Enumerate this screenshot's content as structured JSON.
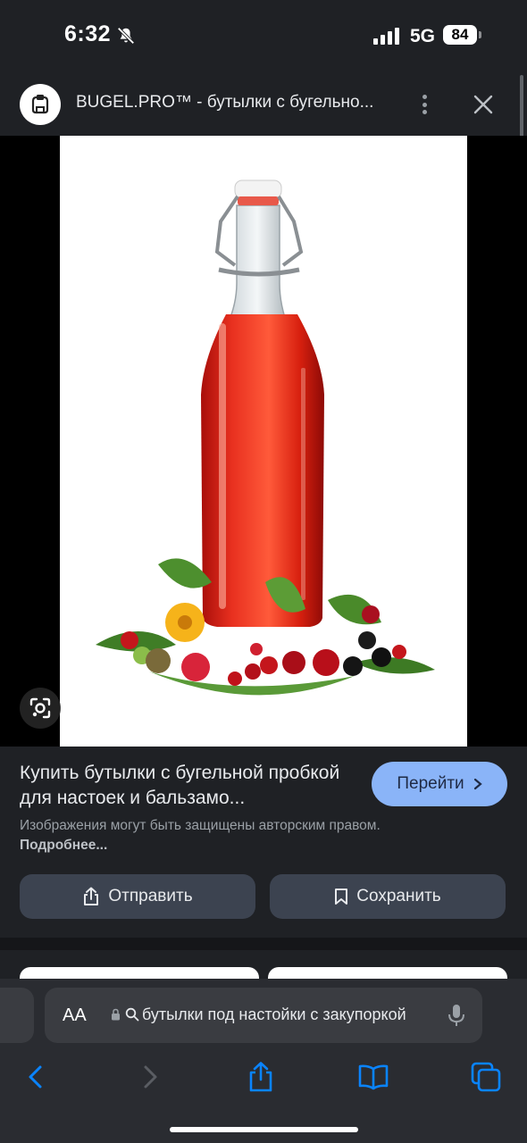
{
  "status_bar": {
    "time": "6:32",
    "network": "5G",
    "battery": "84"
  },
  "header": {
    "site_title": "BUGEL.PRO™ - бутылки с бугельно..."
  },
  "result": {
    "title": "Купить бутылки с бугельной пробкой для настоек и бальзамо...",
    "go_label": "Перейти",
    "copyright_text": "Изображения могут быть защищены авторским правом.",
    "more_link": "Подробнее...",
    "share_label": "Отправить",
    "save_label": "Сохранить"
  },
  "browser": {
    "text_size_label": "AA",
    "url_text": "бутылки под настойки с закупоркой"
  },
  "colors": {
    "accent": "#8ab4f8",
    "background": "#1f2125",
    "button": "#3c4350",
    "ios_blue": "#0a84ff"
  },
  "icons": [
    "bell-slash-icon",
    "signal-icon",
    "battery-icon",
    "site-logo",
    "more-vert-icon",
    "close-icon",
    "lens-icon",
    "chevron-right-icon",
    "share-icon",
    "bookmark-icon",
    "lock-icon",
    "search-icon",
    "mic-icon",
    "back-icon",
    "forward-icon",
    "tabs-icon"
  ]
}
